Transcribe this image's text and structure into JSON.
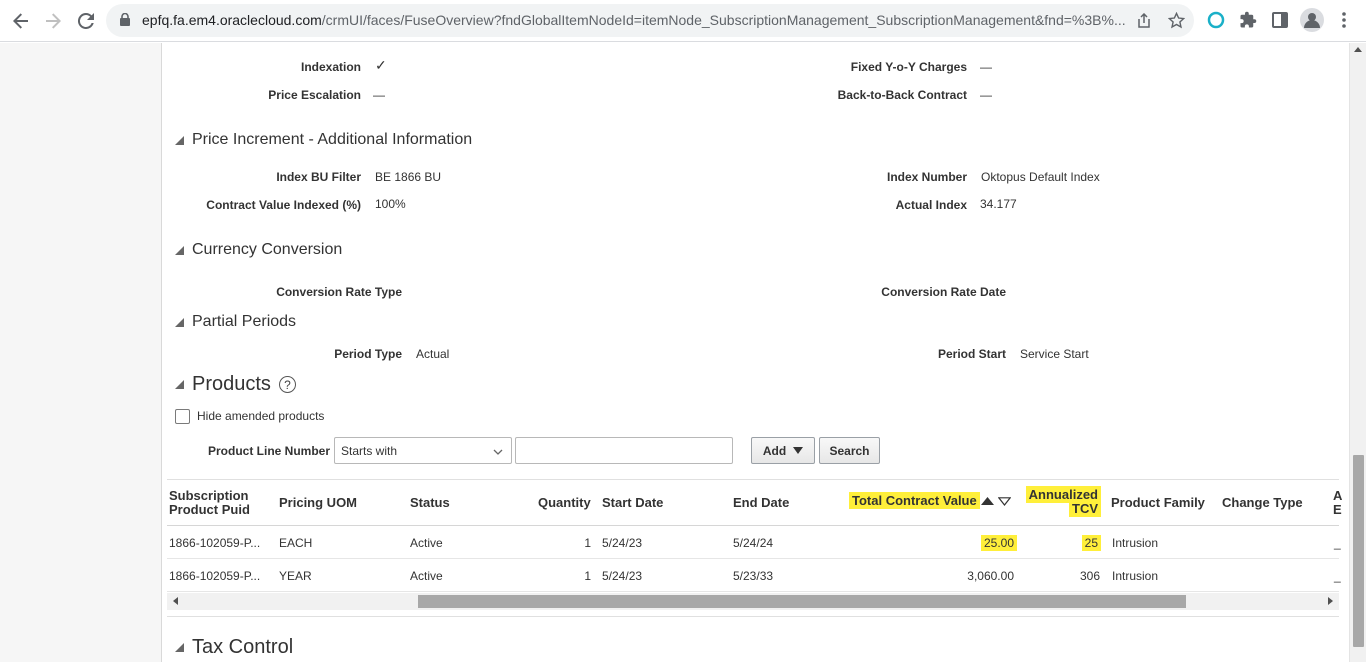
{
  "browser": {
    "url_host": "epfq.fa.em4.oraclecloud.com",
    "url_path": "/crmUI/faces/FuseOverview?fndGlobalItemNodeId=itemNode_SubscriptionManagement_SubscriptionManagement&fnd=%3B%..."
  },
  "pricing": {
    "indexation_label": "Indexation",
    "indexation_value": "✓",
    "price_escalation_label": "Price Escalation",
    "price_escalation_value": "—",
    "fixed_yoy_label": "Fixed Y-o-Y Charges",
    "fixed_yoy_value": "—",
    "back_to_back_label": "Back-to-Back Contract",
    "back_to_back_value": "—"
  },
  "price_increment": {
    "title": "Price Increment - Additional Information",
    "index_bu_filter_label": "Index BU Filter",
    "index_bu_filter_value": "BE 1866 BU",
    "contract_value_indexed_label": "Contract Value Indexed (%)",
    "contract_value_indexed_value": "100%",
    "index_number_label": "Index Number",
    "index_number_value": "Oktopus Default Index",
    "actual_index_label": "Actual Index",
    "actual_index_value": "34.177"
  },
  "currency_conversion": {
    "title": "Currency Conversion",
    "rate_type_label": "Conversion Rate Type",
    "rate_date_label": "Conversion Rate Date"
  },
  "partial_periods": {
    "title": "Partial Periods",
    "period_type_label": "Period Type",
    "period_type_value": "Actual",
    "period_start_label": "Period Start",
    "period_start_value": "Service Start"
  },
  "products": {
    "title": "Products",
    "help_glyph": "?",
    "hide_amended_label": "Hide amended products",
    "product_line_label": "Product Line Number",
    "operator_value": "Starts with",
    "add_label": "Add",
    "search_label": "Search",
    "columns": {
      "puid_line1": "Subscription",
      "puid_line2": "Product Puid",
      "pricing_uom": "Pricing UOM",
      "status": "Status",
      "quantity": "Quantity",
      "start_date": "Start Date",
      "end_date": "End Date",
      "tcv": "Total Contract Value",
      "annualized_line1": "Annualized",
      "annualized_line2": "TCV",
      "product_family": "Product Family",
      "change_type": "Change Type",
      "cut_line1": "A",
      "cut_line2": "E"
    },
    "rows": [
      {
        "puid": "1866-102059-P...",
        "uom": "EACH",
        "status": "Active",
        "quantity": "1",
        "start": "5/24/23",
        "end": "5/24/24",
        "tcv": "25.00",
        "annualized": "25",
        "family": "Intrusion",
        "cut": "_"
      },
      {
        "puid": "1866-102059-P...",
        "uom": "YEAR",
        "status": "Active",
        "quantity": "1",
        "start": "5/24/23",
        "end": "5/23/33",
        "tcv": "3,060.00",
        "annualized": "306",
        "family": "Intrusion",
        "cut": "_"
      }
    ]
  },
  "tax_control": {
    "title": "Tax Control"
  },
  "colors": {
    "highlight": "#ffef3a",
    "text": "#333333"
  }
}
